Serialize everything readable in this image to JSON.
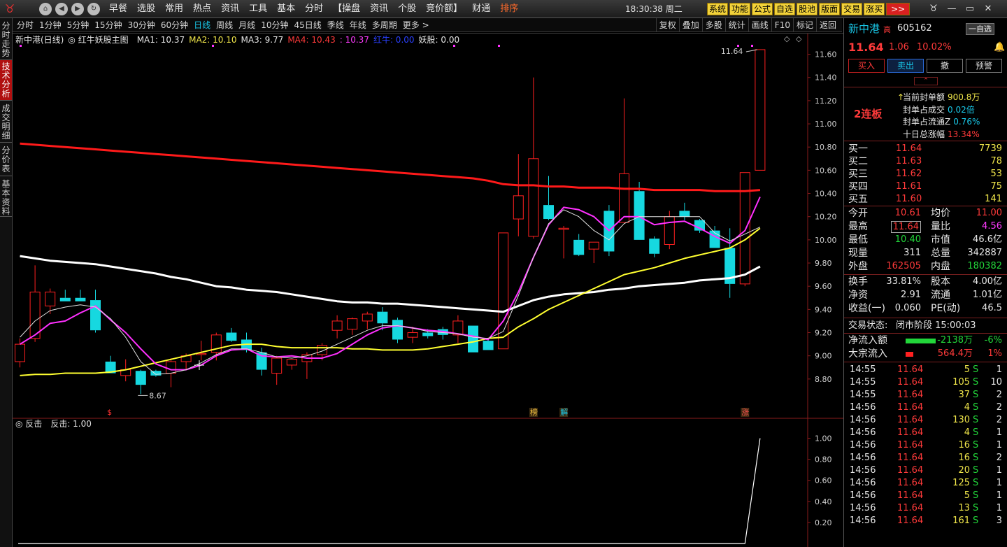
{
  "menu": {
    "items": [
      "早餐",
      "选股",
      "常用",
      "热点",
      "资讯",
      "工具",
      "基本",
      "分时",
      "【操盘",
      "资讯",
      "个股",
      "竞价额】",
      "财通",
      "排序"
    ],
    "clock": "18:30:38 周二",
    "sys_buttons": [
      "系统",
      "功能",
      "公式",
      "自选",
      "股池",
      "版面",
      "交易",
      "涨买"
    ],
    "more_label": ">>"
  },
  "left_tabs": [
    "分时走势",
    "技术分析",
    "成交明细",
    "分价表",
    "基本资料"
  ],
  "periods": [
    "分时",
    "1分钟",
    "5分钟",
    "15分钟",
    "30分钟",
    "60分钟",
    "日线",
    "周线",
    "月线",
    "10分钟",
    "45日线",
    "季线",
    "年线",
    "多周期",
    "更多 >"
  ],
  "tools": [
    "复权",
    "叠加",
    "多股",
    "统计",
    "画线",
    "F10",
    "标记",
    "返回"
  ],
  "legend": {
    "stock": "新中港(日线)",
    "formula": "红牛妖股主图",
    "ma1": "MA1: 10.37",
    "ma2": "MA2: 10.10",
    "ma3": "MA3: 9.77",
    "ma4": "MA4: 10.43",
    "ma5": ": 10.37",
    "hongniu": "红牛: 0.00",
    "yaogu": "妖股: 0.00"
  },
  "sub_legend": {
    "name": "反击",
    "value": "反击: 1.00"
  },
  "colors": {
    "up": "#ff2020",
    "down": "#16d8e0",
    "ma_red": "#ff1a1a",
    "ma_white": "#ffffff",
    "ma_yellow": "#ffff30",
    "ma_magenta": "#ff30ff"
  },
  "chart_data": [
    {
      "type": "candlestick",
      "ylim": [
        8.6,
        11.7
      ],
      "y_ticks": [
        "11.60",
        "11.40",
        "11.20",
        "11.00",
        "10.80",
        "10.60",
        "10.40",
        "10.20",
        "10.00",
        "9.80",
        "9.60",
        "9.40",
        "9.20",
        "9.00",
        "8.80"
      ],
      "y_tick_values": [
        11.6,
        11.4,
        11.2,
        11.0,
        10.8,
        10.6,
        10.4,
        10.2,
        10.0,
        9.8,
        9.6,
        9.4,
        9.2,
        9.0,
        8.8
      ],
      "candles": [
        {
          "o": 8.95,
          "h": 9.15,
          "l": 8.9,
          "c": 9.1
        },
        {
          "o": 9.15,
          "h": 9.78,
          "l": 9.12,
          "c": 9.55
        },
        {
          "o": 9.43,
          "h": 9.58,
          "l": 9.36,
          "c": 9.55
        },
        {
          "o": 9.5,
          "h": 9.57,
          "l": 9.47,
          "c": 9.47
        },
        {
          "o": 9.5,
          "h": 9.57,
          "l": 9.47,
          "c": 9.47
        },
        {
          "o": 9.48,
          "h": 9.57,
          "l": 9.2,
          "c": 9.22
        },
        {
          "o": 8.95,
          "h": 9.0,
          "l": 8.85,
          "c": 8.85
        },
        {
          "o": 8.83,
          "h": 8.97,
          "l": 8.78,
          "c": 8.88
        },
        {
          "o": 8.87,
          "h": 8.88,
          "l": 8.67,
          "c": 8.75
        },
        {
          "o": 8.87,
          "h": 8.88,
          "l": 8.82,
          "c": 8.83
        },
        {
          "o": 8.85,
          "h": 8.98,
          "l": 8.73,
          "c": 8.95
        },
        {
          "o": 8.95,
          "h": 9.02,
          "l": 8.88,
          "c": 9.0
        },
        {
          "o": 9.02,
          "h": 9.13,
          "l": 8.96,
          "c": 9.02
        },
        {
          "o": 9.03,
          "h": 9.2,
          "l": 8.96,
          "c": 9.18
        },
        {
          "o": 9.2,
          "h": 9.24,
          "l": 9.12,
          "c": 9.13
        },
        {
          "o": 9.14,
          "h": 9.2,
          "l": 9.03,
          "c": 9.05
        },
        {
          "o": 9.03,
          "h": 9.07,
          "l": 8.83,
          "c": 8.88
        },
        {
          "o": 8.85,
          "h": 9.0,
          "l": 8.75,
          "c": 8.98
        },
        {
          "o": 8.92,
          "h": 8.97,
          "l": 8.88,
          "c": 8.97
        },
        {
          "o": 8.95,
          "h": 9.03,
          "l": 8.8,
          "c": 9.01
        },
        {
          "o": 9.01,
          "h": 9.11,
          "l": 8.96,
          "c": 9.09
        },
        {
          "o": 9.22,
          "h": 9.35,
          "l": 9.15,
          "c": 9.3
        },
        {
          "o": 9.23,
          "h": 9.33,
          "l": 9.18,
          "c": 9.32
        },
        {
          "o": 9.3,
          "h": 9.38,
          "l": 9.23,
          "c": 9.36
        },
        {
          "o": 9.38,
          "h": 9.42,
          "l": 9.22,
          "c": 9.28
        },
        {
          "o": 9.31,
          "h": 9.33,
          "l": 9.11,
          "c": 9.14
        },
        {
          "o": 9.16,
          "h": 9.25,
          "l": 9.11,
          "c": 9.2
        },
        {
          "o": 9.2,
          "h": 9.23,
          "l": 9.15,
          "c": 9.17
        },
        {
          "o": 9.23,
          "h": 9.25,
          "l": 9.14,
          "c": 9.18
        },
        {
          "o": 9.18,
          "h": 9.35,
          "l": 9.11,
          "c": 9.3
        },
        {
          "o": 9.26,
          "h": 9.26,
          "l": 9.03,
          "c": 9.03
        },
        {
          "o": 9.13,
          "h": 9.15,
          "l": 9.05,
          "c": 9.05
        },
        {
          "o": 9.06,
          "h": 10.06,
          "l": 9.06,
          "c": 10.06
        },
        {
          "o": 10.18,
          "h": 10.74,
          "l": 10.03,
          "c": 10.38
        },
        {
          "o": 10.03,
          "h": 11.4,
          "l": 10.01,
          "c": 10.7
        },
        {
          "o": 10.3,
          "h": 10.55,
          "l": 10.17,
          "c": 10.18
        },
        {
          "o": 10.09,
          "h": 10.12,
          "l": 9.84,
          "c": 10.1
        },
        {
          "o": 10.0,
          "h": 10.05,
          "l": 9.86,
          "c": 9.87
        },
        {
          "o": 9.92,
          "h": 9.98,
          "l": 9.8,
          "c": 9.98
        },
        {
          "o": 10.25,
          "h": 10.3,
          "l": 9.86,
          "c": 9.9
        },
        {
          "o": 10.15,
          "h": 11.22,
          "l": 10.15,
          "c": 10.57
        },
        {
          "o": 10.42,
          "h": 10.5,
          "l": 10.0,
          "c": 10.0
        },
        {
          "o": 10.01,
          "h": 10.03,
          "l": 9.85,
          "c": 9.88
        },
        {
          "o": 9.96,
          "h": 10.25,
          "l": 9.92,
          "c": 10.2
        },
        {
          "o": 10.25,
          "h": 10.32,
          "l": 10.17,
          "c": 10.2
        },
        {
          "o": 10.17,
          "h": 10.18,
          "l": 10.06,
          "c": 10.08
        },
        {
          "o": 10.08,
          "h": 10.12,
          "l": 9.93,
          "c": 9.93
        },
        {
          "o": 9.93,
          "h": 10.1,
          "l": 9.5,
          "c": 9.62
        },
        {
          "o": 9.62,
          "h": 10.58,
          "l": 9.6,
          "c": 10.58
        },
        {
          "o": 10.6,
          "h": 11.64,
          "l": 10.6,
          "c": 11.64
        }
      ],
      "ma_white": [
        9.86,
        9.84,
        9.82,
        9.81,
        9.8,
        9.79,
        9.77,
        9.75,
        9.73,
        9.71,
        9.68,
        9.66,
        9.63,
        9.6,
        9.59,
        9.57,
        9.56,
        9.55,
        9.53,
        9.51,
        9.49,
        9.47,
        9.46,
        9.46,
        9.45,
        9.45,
        9.44,
        9.43,
        9.42,
        9.41,
        9.4,
        9.39,
        9.38,
        9.43,
        9.48,
        9.51,
        9.53,
        9.54,
        9.55,
        9.57,
        9.58,
        9.6,
        9.61,
        9.62,
        9.63,
        9.65,
        9.66,
        9.67,
        9.7,
        9.77
      ],
      "ma_red": [
        10.83,
        10.82,
        10.81,
        10.8,
        10.79,
        10.78,
        10.77,
        10.76,
        10.75,
        10.74,
        10.73,
        10.72,
        10.71,
        10.7,
        10.69,
        10.68,
        10.67,
        10.66,
        10.65,
        10.64,
        10.63,
        10.62,
        10.61,
        10.6,
        10.59,
        10.58,
        10.57,
        10.56,
        10.55,
        10.54,
        10.53,
        10.51,
        10.48,
        10.47,
        10.47,
        10.46,
        10.46,
        10.45,
        10.45,
        10.45,
        10.44,
        10.44,
        10.43,
        10.43,
        10.43,
        10.43,
        10.42,
        10.42,
        10.42,
        10.43
      ],
      "ma_yellow": [
        8.83,
        8.84,
        8.84,
        8.85,
        8.85,
        8.85,
        8.86,
        8.88,
        8.91,
        8.94,
        8.97,
        9.0,
        9.03,
        9.06,
        9.09,
        9.1,
        9.1,
        9.08,
        9.07,
        9.07,
        9.07,
        9.07,
        9.06,
        9.06,
        9.05,
        9.05,
        9.05,
        9.06,
        9.08,
        9.1,
        9.12,
        9.15,
        9.16,
        9.25,
        9.32,
        9.4,
        9.46,
        9.52,
        9.58,
        9.64,
        9.7,
        9.73,
        9.76,
        9.8,
        9.84,
        9.87,
        9.9,
        9.93,
        10.0,
        10.1
      ],
      "ma_magenta": [
        9.1,
        9.18,
        9.28,
        9.3,
        9.37,
        9.43,
        9.31,
        9.2,
        9.06,
        8.93,
        8.88,
        8.88,
        8.92,
        9.0,
        9.05,
        9.06,
        9.0,
        8.99,
        9.0,
        8.98,
        8.98,
        9.02,
        9.1,
        9.18,
        9.24,
        9.26,
        9.24,
        9.22,
        9.21,
        9.19,
        9.17,
        9.14,
        9.3,
        9.55,
        9.85,
        10.13,
        10.28,
        10.26,
        10.2,
        10.08,
        10.2,
        10.2,
        10.13,
        10.15,
        10.16,
        10.1,
        10.03,
        9.97,
        10.08,
        10.37
      ],
      "ma_thin": [
        9.16,
        9.3,
        9.39,
        9.42,
        9.44,
        9.42,
        9.32,
        9.16,
        8.95,
        8.84,
        8.85,
        8.88,
        8.94,
        9.01,
        9.06,
        9.06,
        9.03,
        8.99,
        8.98,
        9.0,
        9.04,
        9.1,
        9.16,
        9.22,
        9.26,
        9.26,
        9.24,
        9.21,
        9.2,
        9.19,
        9.16,
        9.15,
        9.21,
        9.52,
        9.85,
        10.14,
        10.26,
        10.2,
        10.08,
        10.0,
        10.14,
        10.2,
        10.2,
        10.2,
        10.2,
        10.2,
        10.06,
        9.99,
        10.05,
        10.11
      ],
      "annotations": {
        "low_label": "8.67",
        "high_label": "11.64"
      },
      "event_markers": [
        "$",
        "榜",
        "解",
        "涨"
      ]
    },
    {
      "type": "line",
      "name": "反击",
      "ylim": [
        0,
        1.05
      ],
      "y_ticks": [
        "1.00",
        "0.80",
        "0.60",
        "0.40",
        "0.20"
      ],
      "y_tick_values": [
        1.0,
        0.8,
        0.6,
        0.4,
        0.2
      ],
      "values": [
        0,
        0,
        0,
        0,
        0,
        0,
        0,
        0,
        0,
        0,
        0,
        0,
        0,
        0,
        0,
        0,
        0,
        0,
        0,
        0,
        0,
        0,
        0,
        0,
        0,
        0,
        0,
        0,
        0,
        0,
        0,
        0,
        0,
        0,
        0,
        0,
        0,
        0,
        0,
        0,
        0,
        0,
        0,
        0,
        0,
        0,
        0,
        0,
        0,
        1
      ]
    }
  ],
  "quote": {
    "name": "新中港",
    "tag": "高",
    "code": "605162",
    "price": "11.64",
    "change": "1.06",
    "pct": "10.02%",
    "watch_btn": "一自选",
    "actions": [
      "买入",
      "卖出",
      "撤",
      "预警"
    ],
    "board": "2连板",
    "seal": [
      {
        "label": "当前封单额",
        "value": "900.8万"
      },
      {
        "label": "封单占成交",
        "value": "0.02倍"
      },
      {
        "label": "封单占流通Z",
        "value": "0.76%"
      },
      {
        "label": "十日总涨幅",
        "value": "13.34%"
      }
    ],
    "bids": [
      {
        "label": "买一",
        "price": "11.64",
        "vol": "7739"
      },
      {
        "label": "买二",
        "price": "11.63",
        "vol": "78"
      },
      {
        "label": "买三",
        "price": "11.62",
        "vol": "53"
      },
      {
        "label": "买四",
        "price": "11.61",
        "vol": "75"
      },
      {
        "label": "买五",
        "price": "11.60",
        "vol": "141"
      }
    ],
    "stats1": [
      [
        "今开",
        "10.61",
        "均价",
        "11.00"
      ],
      [
        "最高",
        "11.64",
        "量比",
        "4.56"
      ],
      [
        "最低",
        "10.40",
        "市值",
        "46.6亿"
      ],
      [
        "现量",
        "311",
        "总量",
        "342887"
      ],
      [
        "外盘",
        "162505",
        "内盘",
        "180382"
      ]
    ],
    "stats2": [
      [
        "换手",
        "33.81%",
        "股本",
        "4.00亿"
      ],
      [
        "净资",
        "2.91",
        "流通",
        "1.01亿"
      ],
      [
        "收益(一)",
        "0.060",
        "PE(动)",
        "46.5"
      ]
    ],
    "status_label": "交易状态:",
    "status_value": "闭市阶段 15:00:03",
    "flow": [
      {
        "label": "净流入额",
        "value": "-2138万",
        "pct": "-6%",
        "bar": 0.6
      },
      {
        "label": "大宗流入",
        "value": "564.4万",
        "pct": "1%",
        "bar": 0.15
      }
    ],
    "ticks": [
      [
        "14:55",
        "11.64",
        "5",
        "S",
        "1"
      ],
      [
        "14:55",
        "11.64",
        "105",
        "S",
        "10"
      ],
      [
        "14:55",
        "11.64",
        "37",
        "S",
        "2"
      ],
      [
        "14:56",
        "11.64",
        "4",
        "S",
        "2"
      ],
      [
        "14:56",
        "11.64",
        "130",
        "S",
        "2"
      ],
      [
        "14:56",
        "11.64",
        "4",
        "S",
        "1"
      ],
      [
        "14:56",
        "11.64",
        "16",
        "S",
        "1"
      ],
      [
        "14:56",
        "11.64",
        "16",
        "S",
        "2"
      ],
      [
        "14:56",
        "11.64",
        "20",
        "S",
        "1"
      ],
      [
        "14:56",
        "11.64",
        "125",
        "S",
        "1"
      ],
      [
        "14:56",
        "11.64",
        "5",
        "S",
        "1"
      ],
      [
        "14:56",
        "11.64",
        "13",
        "S",
        "1"
      ],
      [
        "14:56",
        "11.64",
        "161",
        "S",
        "3"
      ]
    ]
  }
}
